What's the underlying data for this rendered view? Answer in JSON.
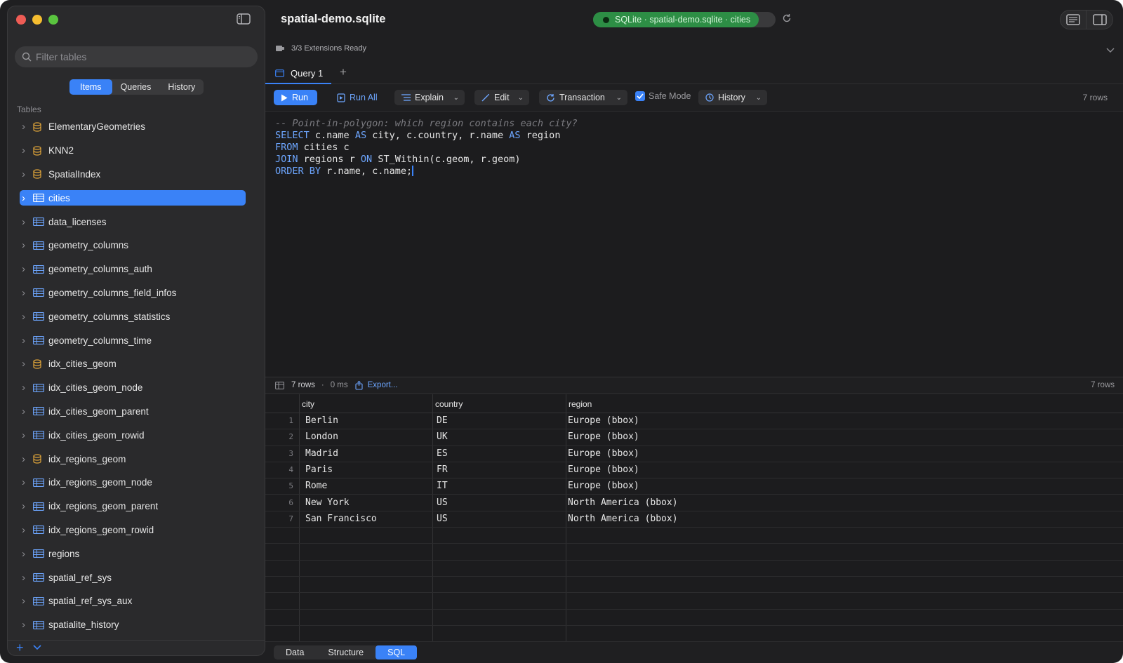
{
  "window": {
    "title": "spatial-demo.sqlite"
  },
  "connection": {
    "label": "SQLite · spatial-demo.sqlite · cities",
    "color": "#2d8e45"
  },
  "sidebar": {
    "search_placeholder": "Filter tables",
    "segments": [
      "Items",
      "Queries",
      "History"
    ],
    "active_segment": "Items",
    "section_label": "Tables",
    "items": [
      {
        "label": "ElementaryGeometries",
        "kind": "db-icon"
      },
      {
        "label": "KNN2",
        "kind": "db-icon"
      },
      {
        "label": "SpatialIndex",
        "kind": "db-icon"
      },
      {
        "label": "cities",
        "kind": "table-icon",
        "selected": true
      },
      {
        "label": "data_licenses",
        "kind": "table-icon"
      },
      {
        "label": "geometry_columns",
        "kind": "table-icon"
      },
      {
        "label": "geometry_columns_auth",
        "kind": "table-icon"
      },
      {
        "label": "geometry_columns_field_infos",
        "kind": "table-icon"
      },
      {
        "label": "geometry_columns_statistics",
        "kind": "table-icon"
      },
      {
        "label": "geometry_columns_time",
        "kind": "table-icon"
      },
      {
        "label": "idx_cities_geom",
        "kind": "db-icon"
      },
      {
        "label": "idx_cities_geom_node",
        "kind": "table-icon"
      },
      {
        "label": "idx_cities_geom_parent",
        "kind": "table-icon"
      },
      {
        "label": "idx_cities_geom_rowid",
        "kind": "table-icon"
      },
      {
        "label": "idx_regions_geom",
        "kind": "db-icon"
      },
      {
        "label": "idx_regions_geom_node",
        "kind": "table-icon"
      },
      {
        "label": "idx_regions_geom_parent",
        "kind": "table-icon"
      },
      {
        "label": "idx_regions_geom_rowid",
        "kind": "table-icon"
      },
      {
        "label": "regions",
        "kind": "table-icon"
      },
      {
        "label": "spatial_ref_sys",
        "kind": "table-icon"
      },
      {
        "label": "spatial_ref_sys_aux",
        "kind": "table-icon"
      },
      {
        "label": "spatialite_history",
        "kind": "table-icon"
      }
    ],
    "accent": "#3a82f7"
  },
  "extensions": {
    "label": "3/3 Extensions Ready"
  },
  "tabs": [
    {
      "label": "Query 1"
    }
  ],
  "toolbar": {
    "run": "Run",
    "run_all": "Run All",
    "explain": "Explain",
    "edit": "Edit",
    "transaction": "Transaction",
    "safe_mode": "Safe Mode",
    "history": "History",
    "row_count": "7 rows"
  },
  "editor": {
    "lines": [
      [
        {
          "t": "-- Point-in-polygon: which region contains each city?",
          "c": "comment"
        }
      ],
      [
        {
          "t": "SELECT",
          "c": "kw"
        },
        {
          "t": " c.name ",
          "c": ""
        },
        {
          "t": "AS",
          "c": "kw"
        },
        {
          "t": " city, c.country, r.name ",
          "c": ""
        },
        {
          "t": "AS",
          "c": "kw"
        },
        {
          "t": " region",
          "c": ""
        }
      ],
      [
        {
          "t": "FROM",
          "c": "kw"
        },
        {
          "t": " cities c",
          "c": ""
        }
      ],
      [
        {
          "t": "JOIN",
          "c": "kw"
        },
        {
          "t": " regions r ",
          "c": ""
        },
        {
          "t": "ON",
          "c": "kw"
        },
        {
          "t": " ST_Within(c.geom, r.geom)",
          "c": ""
        }
      ],
      [
        {
          "t": "ORDER BY",
          "c": "kw"
        },
        {
          "t": " r.name, c.name;",
          "c": ""
        }
      ]
    ]
  },
  "results": {
    "rows_label": "7 rows",
    "time": "0 ms",
    "export": "Export...",
    "rows_right": "7 rows",
    "columns": [
      "city",
      "country",
      "region"
    ],
    "rows": [
      [
        "1",
        "Berlin",
        "DE",
        "Europe (bbox)"
      ],
      [
        "2",
        "London",
        "UK",
        "Europe (bbox)"
      ],
      [
        "3",
        "Madrid",
        "ES",
        "Europe (bbox)"
      ],
      [
        "4",
        "Paris",
        "FR",
        "Europe (bbox)"
      ],
      [
        "5",
        "Rome",
        "IT",
        "Europe (bbox)"
      ],
      [
        "6",
        "New York",
        "US",
        "North America (bbox)"
      ],
      [
        "7",
        "San Francisco",
        "US",
        "North America (bbox)"
      ]
    ]
  },
  "bottom_tabs": [
    "Data",
    "Structure",
    "SQL"
  ],
  "active_bottom_tab": "SQL"
}
